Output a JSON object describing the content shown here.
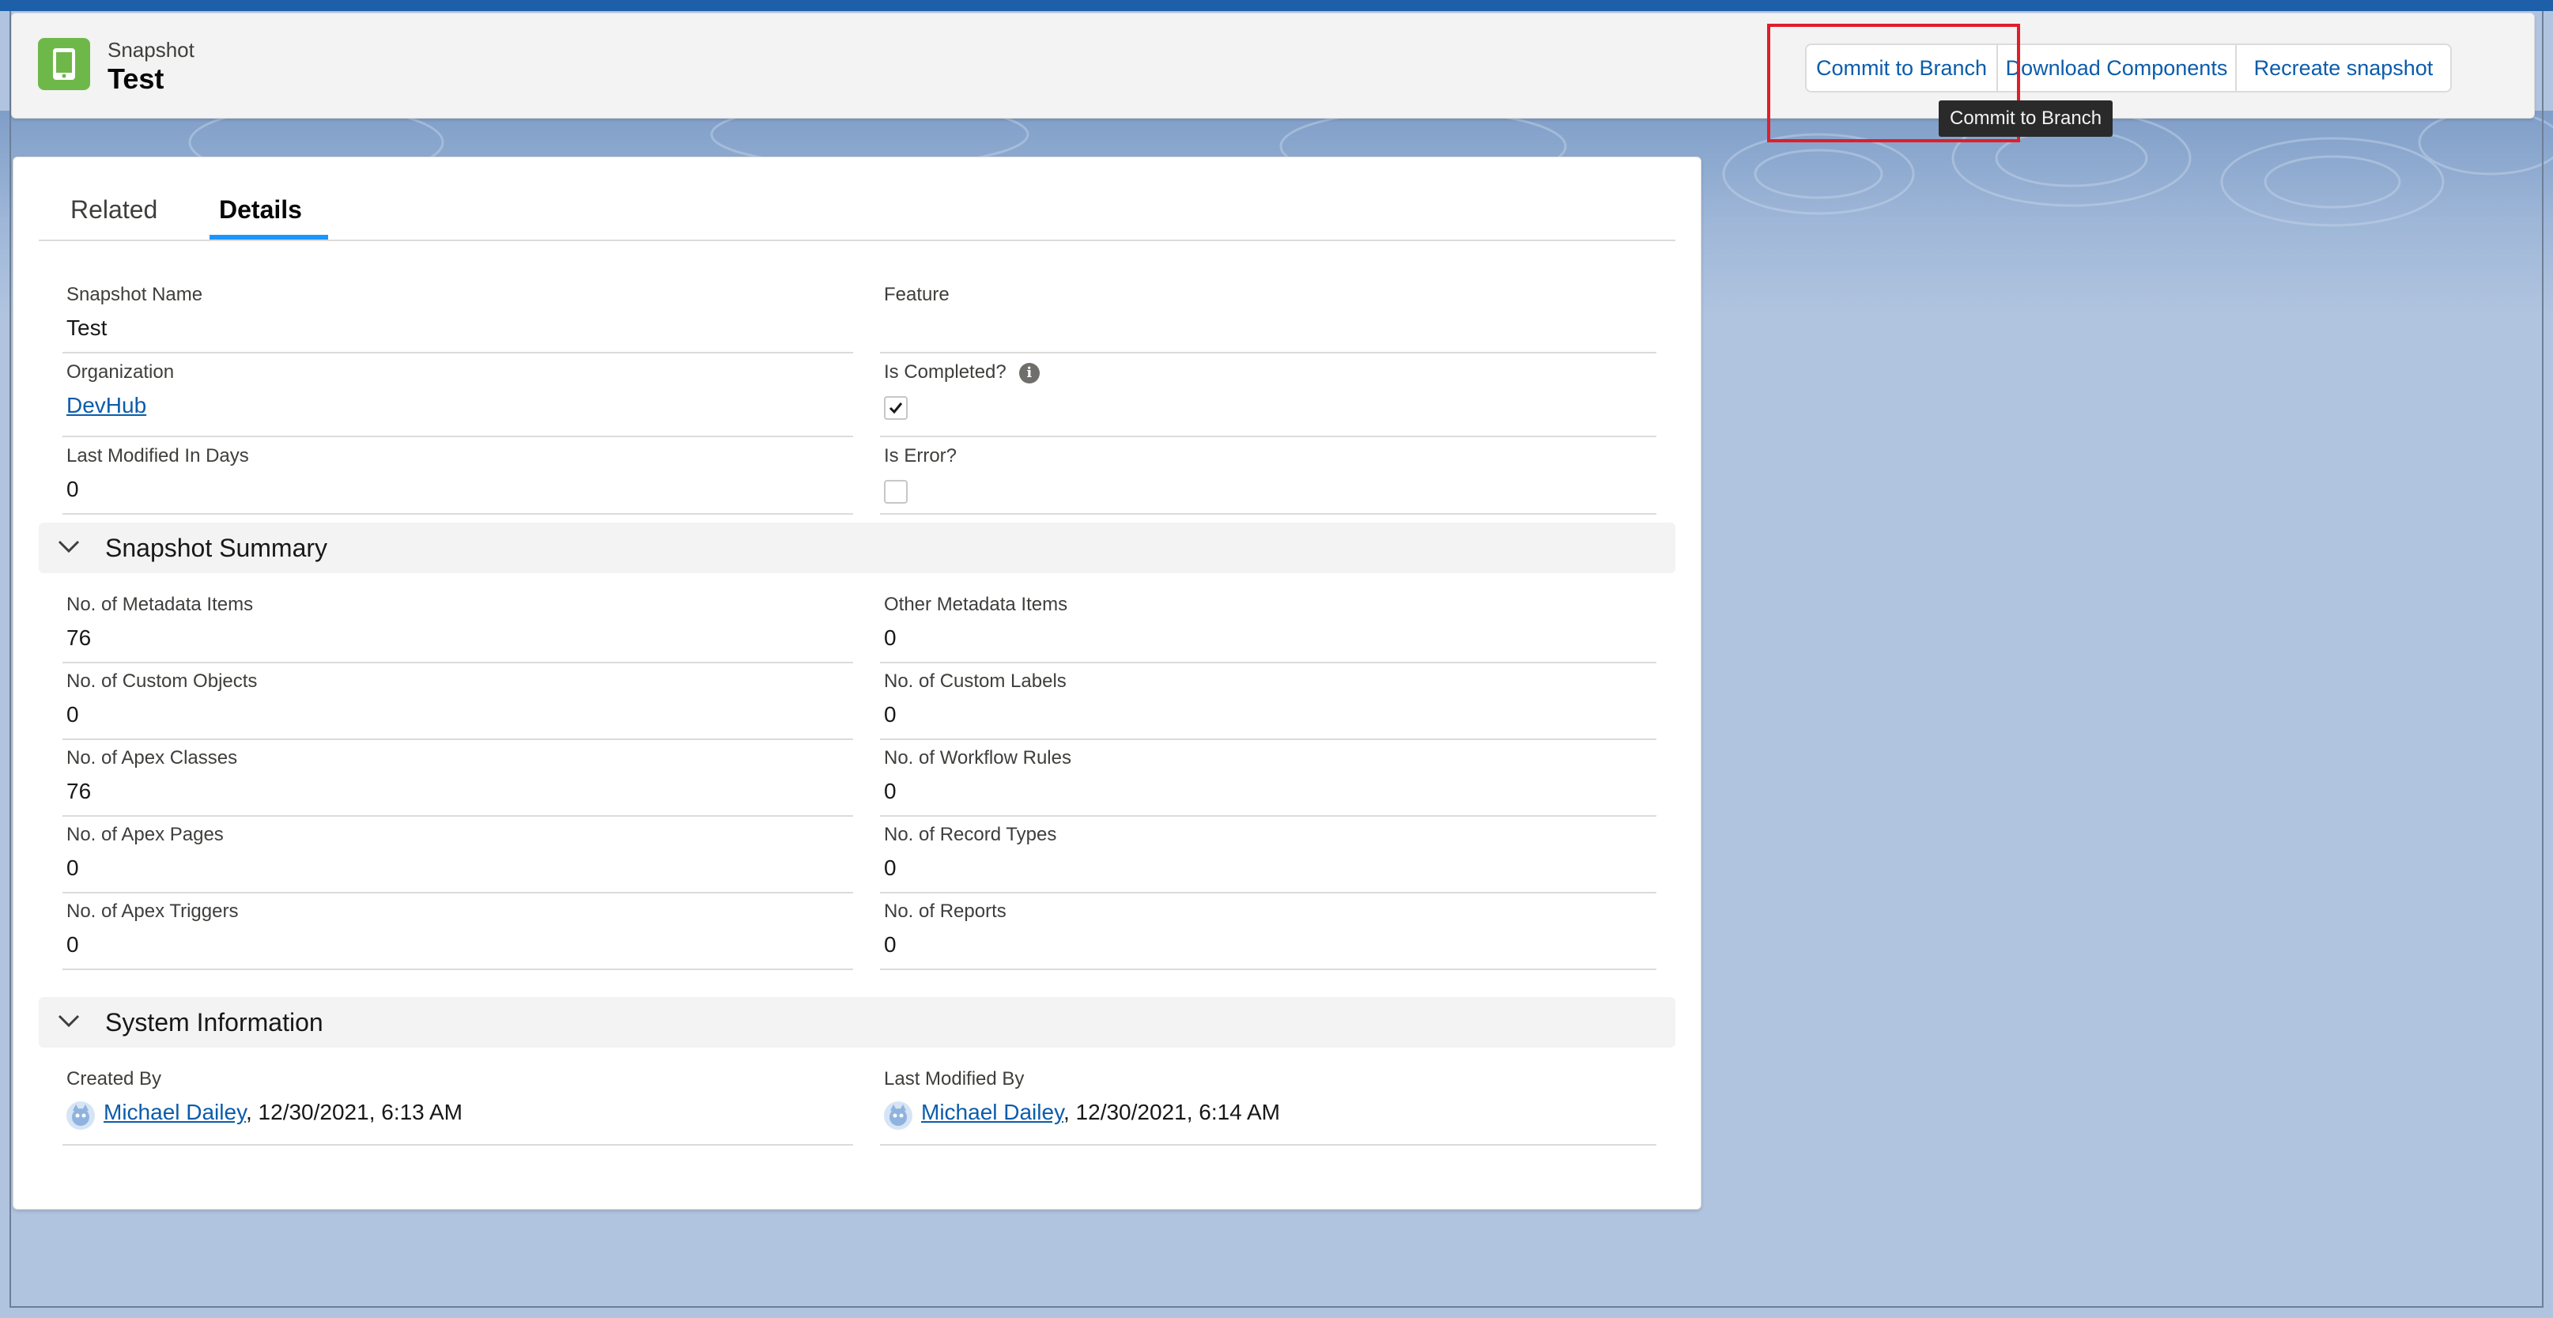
{
  "header": {
    "object_type": "Snapshot",
    "record_name": "Test",
    "actions": [
      {
        "label": "Commit to Branch"
      },
      {
        "label": "Download Components"
      },
      {
        "label": "Recreate snapshot"
      }
    ],
    "tooltip": "Commit to Branch",
    "icon": "mobile-phone-icon",
    "icon_color": "#6eb84a"
  },
  "tabs": [
    {
      "label": "Related",
      "active": false
    },
    {
      "label": "Details",
      "active": true
    }
  ],
  "details": {
    "snapshot_name": {
      "label": "Snapshot Name",
      "value": "Test"
    },
    "feature": {
      "label": "Feature",
      "value": ""
    },
    "organization": {
      "label": "Organization",
      "value": "DevHub"
    },
    "is_completed": {
      "label": "Is Completed?",
      "checked": true
    },
    "last_modified_days": {
      "label": "Last Modified In Days",
      "value": "0"
    },
    "is_error": {
      "label": "Is Error?",
      "checked": false
    }
  },
  "summary": {
    "title": "Snapshot Summary",
    "metadata_items": {
      "label": "No. of Metadata Items",
      "value": "76"
    },
    "other_metadata": {
      "label": "Other Metadata Items",
      "value": "0"
    },
    "custom_objects": {
      "label": "No. of Custom Objects",
      "value": "0"
    },
    "custom_labels": {
      "label": "No. of Custom Labels",
      "value": "0"
    },
    "apex_classes": {
      "label": "No. of Apex Classes",
      "value": "76"
    },
    "workflow_rules": {
      "label": "No. of Workflow Rules",
      "value": "0"
    },
    "apex_pages": {
      "label": "No. of Apex Pages",
      "value": "0"
    },
    "record_types": {
      "label": "No. of Record Types",
      "value": "0"
    },
    "apex_triggers": {
      "label": "No. of Apex Triggers",
      "value": "0"
    },
    "reports": {
      "label": "No. of Reports",
      "value": "0"
    }
  },
  "system": {
    "title": "System Information",
    "created_by": {
      "label": "Created By",
      "user": "Michael Dailey",
      "date": ", 12/30/2021, 6:13 AM"
    },
    "modified_by": {
      "label": "Last Modified By",
      "user": "Michael Dailey",
      "date": ", 12/30/2021, 6:14 AM"
    }
  },
  "colors": {
    "link": "#0b5cab",
    "tab_accent": "#1b96ff",
    "highlight": "#e01e2a"
  }
}
